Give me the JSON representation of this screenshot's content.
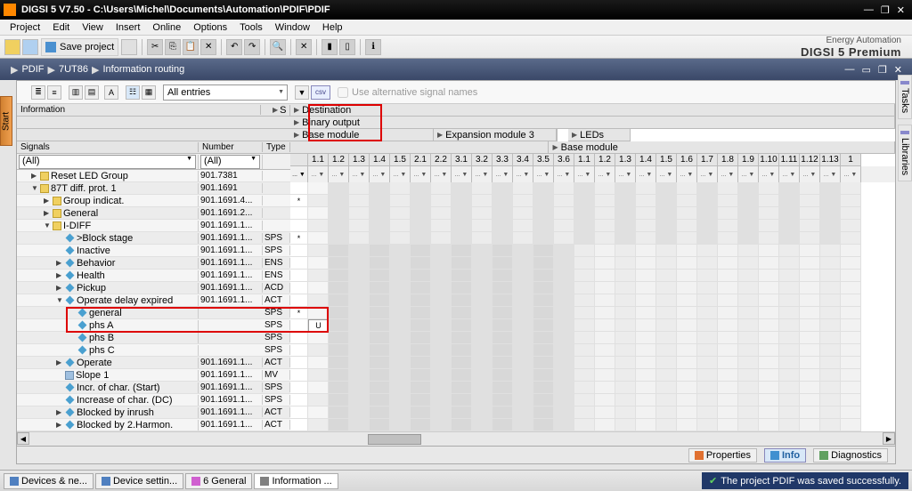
{
  "titleBar": {
    "text": "DIGSI 5 V7.50 - C:\\Users\\Michel\\Documents\\Automation\\PDIF\\PDIF"
  },
  "menu": [
    "Project",
    "Edit",
    "View",
    "Insert",
    "Online",
    "Options",
    "Tools",
    "Window",
    "Help"
  ],
  "toolbar": {
    "saveLabel": "Save project"
  },
  "brand": {
    "line1": "Energy Automation",
    "line2": "DIGSI 5 Premium"
  },
  "breadcrumb": {
    "items": [
      "PDIF",
      "7UT86",
      "Information routing"
    ]
  },
  "startTab": "Start",
  "sideTabs": {
    "tasks": "Tasks",
    "libs": "Libraries"
  },
  "subToolbar": {
    "filterMode": "All entries",
    "altSig": "Use alternative signal names"
  },
  "leftHeader": {
    "info": "Information",
    "signals": "Signals",
    "number": "Number",
    "type": "Type",
    "s": "S",
    "allLeft": "(All)",
    "allNum": "(All)"
  },
  "rightHeader": {
    "destination": "Destination",
    "binaryOutput": "Binary output",
    "baseModule1": "Base module",
    "expansion": "Expansion module 3",
    "leds": "LEDs",
    "baseModule2": "Base module",
    "cols": [
      "1.1",
      "1.2",
      "1.3",
      "1.4",
      "1.5",
      "2.1",
      "2.2",
      "3.1",
      "3.2",
      "3.3",
      "3.4",
      "3.5",
      "3.6",
      "1.1",
      "1.2",
      "1.3",
      "1.4",
      "1.5",
      "1.6",
      "1.7",
      "1.8",
      "1.9",
      "1.10",
      "1.11",
      "1.12",
      "1.13",
      "1"
    ]
  },
  "tree": [
    {
      "indent": 1,
      "exp": "▶",
      "ico": "folder",
      "label": "Reset LED Group",
      "num": "901.7381",
      "type": "",
      "s": "",
      "u": ""
    },
    {
      "indent": 1,
      "exp": "▼",
      "ico": "folder",
      "label": "87T diff. prot. 1",
      "num": "901.1691",
      "type": "",
      "s": "*",
      "u": ""
    },
    {
      "indent": 2,
      "exp": "▶",
      "ico": "folder",
      "label": "Group indicat.",
      "num": "901.1691.4...",
      "type": "",
      "s": "",
      "u": ""
    },
    {
      "indent": 2,
      "exp": "▶",
      "ico": "folder",
      "label": "General",
      "num": "901.1691.2...",
      "type": "",
      "s": "",
      "u": ""
    },
    {
      "indent": 2,
      "exp": "▼",
      "ico": "folder",
      "label": "I-DIFF",
      "num": "901.1691.1...",
      "type": "",
      "s": "*",
      "u": ""
    },
    {
      "indent": 3,
      "exp": "",
      "ico": "diamond",
      "label": ">Block stage",
      "num": "901.1691.1...",
      "type": "SPS",
      "s": "",
      "u": ""
    },
    {
      "indent": 3,
      "exp": "",
      "ico": "diamond",
      "label": "Inactive",
      "num": "901.1691.1...",
      "type": "SPS",
      "s": "",
      "u": ""
    },
    {
      "indent": 3,
      "exp": "▶",
      "ico": "diamond",
      "label": "Behavior",
      "num": "901.1691.1...",
      "type": "ENS",
      "s": "",
      "u": ""
    },
    {
      "indent": 3,
      "exp": "▶",
      "ico": "diamond",
      "label": "Health",
      "num": "901.1691.1...",
      "type": "ENS",
      "s": "",
      "u": ""
    },
    {
      "indent": 3,
      "exp": "▶",
      "ico": "diamond",
      "label": "Pickup",
      "num": "901.1691.1...",
      "type": "ACD",
      "s": "",
      "u": ""
    },
    {
      "indent": 3,
      "exp": "▼",
      "ico": "diamond",
      "label": "Operate delay expired",
      "num": "901.1691.1...",
      "type": "ACT",
      "s": "*",
      "u": ""
    },
    {
      "indent": 4,
      "exp": "",
      "ico": "diamond",
      "label": "general",
      "num": "",
      "type": "SPS",
      "s": "",
      "u": "U"
    },
    {
      "indent": 4,
      "exp": "",
      "ico": "diamond",
      "label": "phs A",
      "num": "",
      "type": "SPS",
      "s": "",
      "u": ""
    },
    {
      "indent": 4,
      "exp": "",
      "ico": "diamond",
      "label": "phs B",
      "num": "",
      "type": "SPS",
      "s": "",
      "u": ""
    },
    {
      "indent": 4,
      "exp": "",
      "ico": "diamond",
      "label": "phs C",
      "num": "",
      "type": "SPS",
      "s": "",
      "u": ""
    },
    {
      "indent": 3,
      "exp": "▶",
      "ico": "diamond",
      "label": "Operate",
      "num": "901.1691.1...",
      "type": "ACT",
      "s": "",
      "u": ""
    },
    {
      "indent": 3,
      "exp": "",
      "ico": "box",
      "label": "Slope 1",
      "num": "901.1691.1...",
      "type": "MV",
      "s": "",
      "u": ""
    },
    {
      "indent": 3,
      "exp": "",
      "ico": "diamond",
      "label": "Incr. of char. (Start)",
      "num": "901.1691.1...",
      "type": "SPS",
      "s": "",
      "u": ""
    },
    {
      "indent": 3,
      "exp": "",
      "ico": "diamond",
      "label": "Increase of char. (DC)",
      "num": "901.1691.1...",
      "type": "SPS",
      "s": "",
      "u": ""
    },
    {
      "indent": 3,
      "exp": "▶",
      "ico": "diamond",
      "label": "Blocked by inrush",
      "num": "901.1691.1...",
      "type": "ACT",
      "s": "",
      "u": ""
    },
    {
      "indent": 3,
      "exp": "▶",
      "ico": "diamond",
      "label": "Blocked by 2.Harmon.",
      "num": "901.1691.1...",
      "type": "ACT",
      "s": "",
      "u": ""
    }
  ],
  "infoPanel": {
    "properties": "Properties",
    "info": "Info",
    "diag": "Diagnostics"
  },
  "statusTabs": [
    "Devices & ne...",
    "Device settin...",
    "6 General",
    "Information ..."
  ],
  "statusMsg": "The project PDIF was saved successfully."
}
